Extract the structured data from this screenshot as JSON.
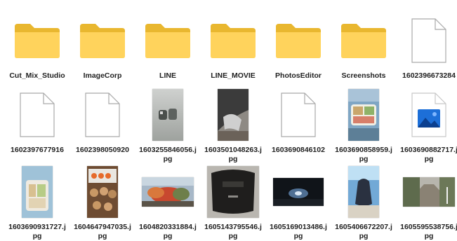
{
  "items": [
    {
      "label": "Cut_Mix_Studio",
      "type": "folder"
    },
    {
      "label": "ImageCorp",
      "type": "folder"
    },
    {
      "label": "LINE",
      "type": "folder"
    },
    {
      "label": "LINE_MOVIE",
      "type": "folder"
    },
    {
      "label": "PhotosEditor",
      "type": "folder"
    },
    {
      "label": "Screenshots",
      "type": "folder"
    },
    {
      "label": "1602396673284",
      "type": "file"
    },
    {
      "label": "1602397677916",
      "type": "file"
    },
    {
      "label": "1602398050920",
      "type": "file"
    },
    {
      "label": "1603255846056.jpg",
      "type": "image"
    },
    {
      "label": "1603501048263.jpg",
      "type": "image"
    },
    {
      "label": "1603690846102",
      "type": "file"
    },
    {
      "label": "1603690858959.jpg",
      "type": "image"
    },
    {
      "label": "1603690882717.jpg",
      "type": "image-icon"
    },
    {
      "label": "1603690931727.jpg",
      "type": "image"
    },
    {
      "label": "1604647947035.jpg",
      "type": "image"
    },
    {
      "label": "1604820331884.jpg",
      "type": "image"
    },
    {
      "label": "1605143795546.jpg",
      "type": "image"
    },
    {
      "label": "1605169013486.jpg",
      "type": "image"
    },
    {
      "label": "1605406672207.jpg",
      "type": "image"
    },
    {
      "label": "1605595538756.jpg",
      "type": "image"
    }
  ],
  "colors": {
    "folder_back": "#e9b72f",
    "folder_front": "#ffd35c",
    "doc_border": "#a9a9a9",
    "image_icon_blue": "#1d6fd8"
  }
}
